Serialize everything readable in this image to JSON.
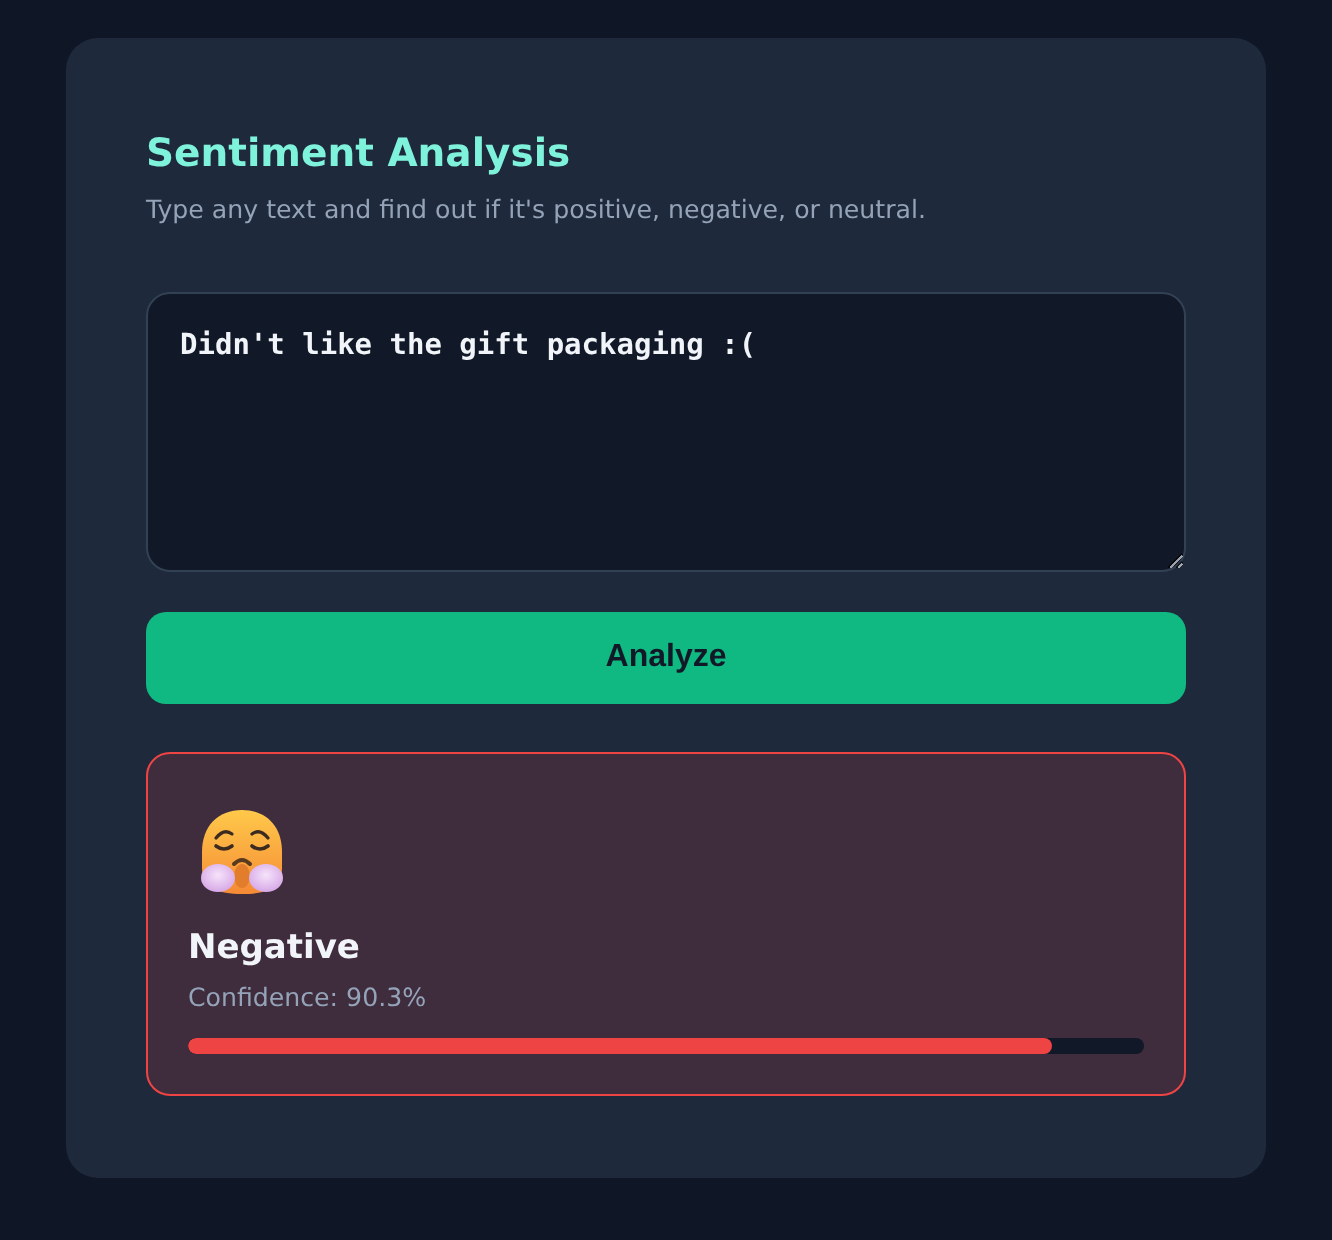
{
  "header": {
    "title": "Sentiment Analysis",
    "subtitle": "Type any text and find out if it's positive, negative, or neutral."
  },
  "input": {
    "value": "Didn't like the gift packaging :("
  },
  "button": {
    "label": "Analyze"
  },
  "result": {
    "kind": "negative",
    "label": "Negative",
    "confidence": "Confidence: 90.3%",
    "level": 0.903
  }
}
